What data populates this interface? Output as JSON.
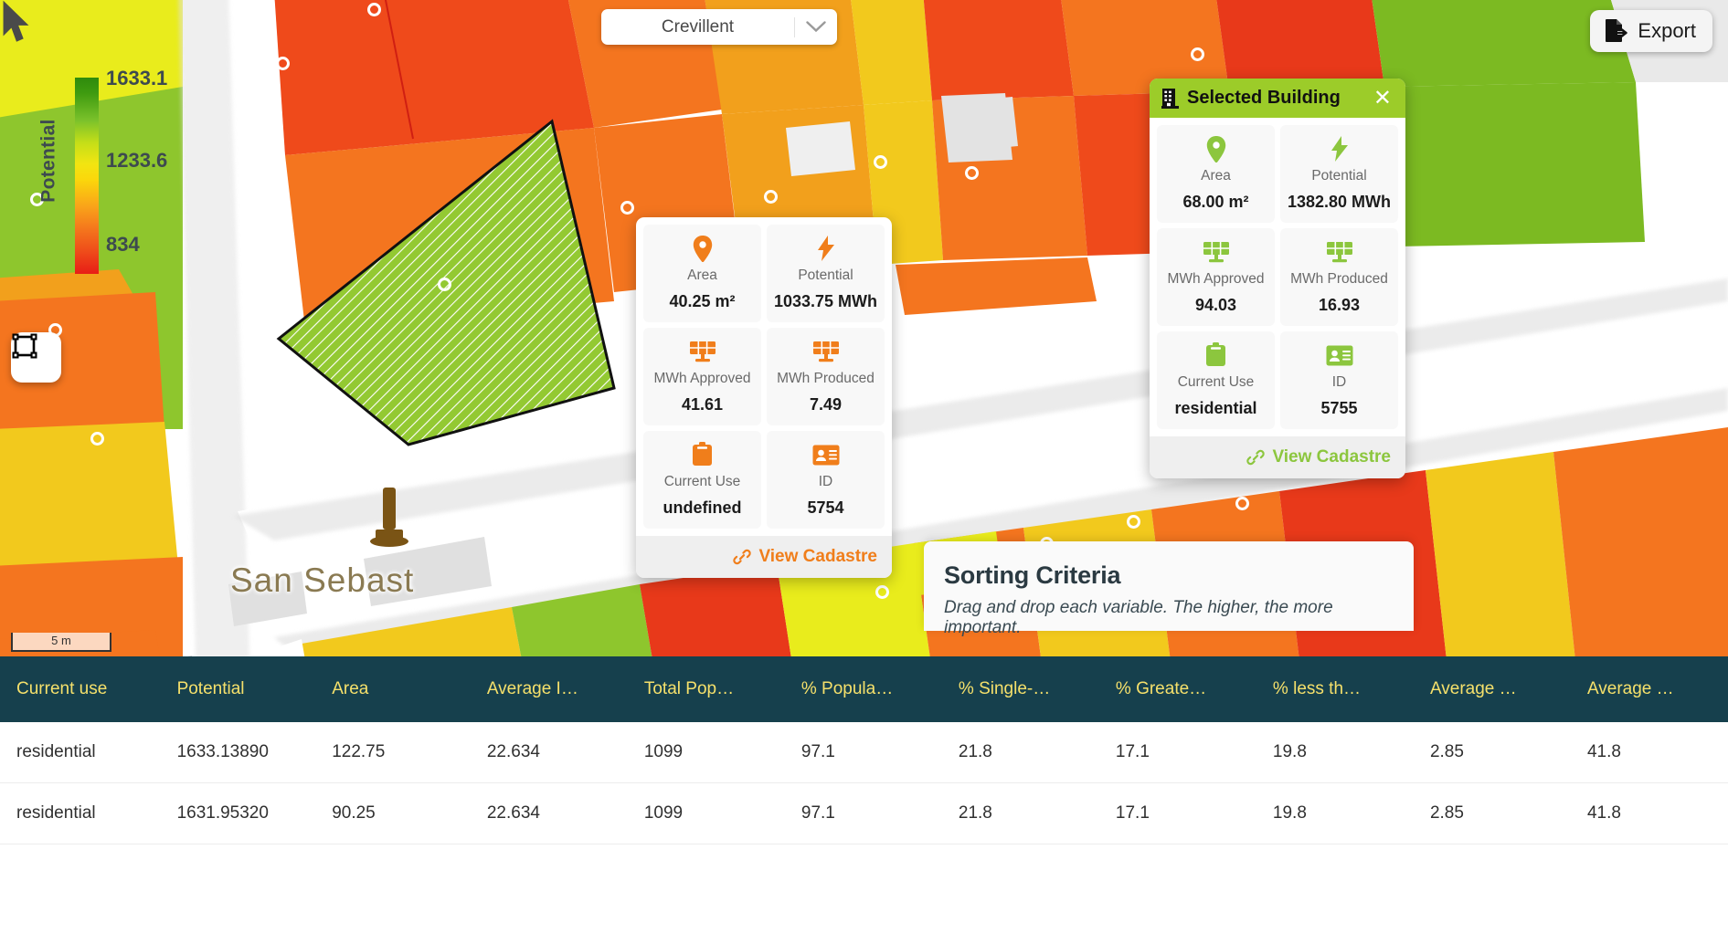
{
  "app": {
    "municipality_selector": {
      "value": "Crevillent",
      "icon": "chevron-down-icon"
    },
    "export_button": {
      "label": "Export",
      "icon": "file-export-icon"
    },
    "draw_tool": {
      "icon": "bounding-box-icon"
    }
  },
  "legend": {
    "title": "Potential",
    "ticks": [
      "1633.1",
      "1233.6",
      "834"
    ],
    "colors": {
      "high": "#2e8b0c",
      "mid": "#f2e511",
      "low": "#e81d16"
    }
  },
  "map": {
    "scalebar_label": "5 m",
    "place_label": "San Sebast",
    "monument_icon": "monument-icon",
    "cursor_icon": "cursor-arrow-icon"
  },
  "info_popup": {
    "cells": [
      {
        "icon": "map-pin-icon",
        "key": "Area",
        "value": "40.25 m²"
      },
      {
        "icon": "lightning-icon",
        "key": "Potential",
        "value": "1033.75 MWh"
      },
      {
        "icon": "solar-panel-icon",
        "key": "MWh Approved",
        "value": "41.61"
      },
      {
        "icon": "solar-panel-icon",
        "key": "MWh Produced",
        "value": "7.49"
      },
      {
        "icon": "clipboard-icon",
        "key": "Current Use",
        "value": "undefined"
      },
      {
        "icon": "id-card-icon",
        "key": "ID",
        "value": "5754"
      }
    ],
    "footer": {
      "label": "View Cadastre",
      "icon": "link-icon",
      "color": "#f07e1b"
    }
  },
  "selected_building": {
    "header": {
      "title": "Selected Building",
      "icon": "building-icon",
      "close_icon": "close-icon",
      "bg": "#9ccc29"
    },
    "cells": [
      {
        "icon": "map-pin-icon",
        "key": "Area",
        "value": "68.00 m²"
      },
      {
        "icon": "lightning-icon",
        "key": "Potential",
        "value": "1382.80 MWh"
      },
      {
        "icon": "solar-panel-icon",
        "key": "MWh Approved",
        "value": "94.03"
      },
      {
        "icon": "solar-panel-icon",
        "key": "MWh Produced",
        "value": "16.93"
      },
      {
        "icon": "clipboard-icon",
        "key": "Current Use",
        "value": "residential"
      },
      {
        "icon": "id-card-icon",
        "key": "ID",
        "value": "5755"
      }
    ],
    "footer": {
      "label": "View Cadastre",
      "icon": "link-icon",
      "color": "#8cc63e"
    }
  },
  "sorting_criteria": {
    "title": "Sorting Criteria",
    "subtitle": "Drag and drop each variable. The higher, the more important."
  },
  "table": {
    "columns": [
      "Current use",
      "Potential",
      "Area",
      "Average I…",
      "Total Pop…",
      "% Popula…",
      "% Single-…",
      "% Greate…",
      "% less th…",
      "Average …",
      "Average …"
    ],
    "rows": [
      [
        "residential",
        "1633.13890",
        "122.75",
        "22.634",
        "1099",
        "97.1",
        "21.8",
        "17.1",
        "19.8",
        "2.85",
        "41.8"
      ],
      [
        "residential",
        "1631.95320",
        "90.25",
        "22.634",
        "1099",
        "97.1",
        "21.8",
        "17.1",
        "19.8",
        "2.85",
        "41.8"
      ]
    ],
    "header_bg": "#16404d",
    "header_color": "#f5e06b"
  }
}
